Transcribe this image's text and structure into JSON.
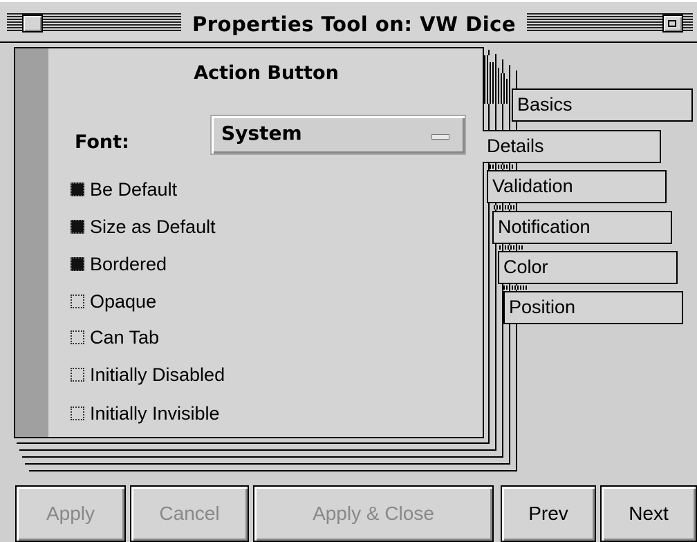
{
  "window": {
    "title": "Properties Tool on: VW Dice"
  },
  "page": {
    "title": "Action Button",
    "font_label": "Font:",
    "font_value": "System"
  },
  "options": [
    {
      "label": "Be Default",
      "checked": true
    },
    {
      "label": "Size as Default",
      "checked": true
    },
    {
      "label": "Bordered",
      "checked": true
    },
    {
      "label": "Opaque",
      "checked": false
    },
    {
      "label": "Can Tab",
      "checked": false
    },
    {
      "label": "Initially Disabled",
      "checked": false
    },
    {
      "label": "Initially Invisible",
      "checked": false
    }
  ],
  "tabs": [
    {
      "label": "Basics"
    },
    {
      "label": "Details",
      "selected": true
    },
    {
      "label": "Validation"
    },
    {
      "label": "Notification"
    },
    {
      "label": "Color"
    },
    {
      "label": "Position"
    }
  ],
  "buttons": {
    "apply": {
      "label": "Apply",
      "enabled": false
    },
    "cancel": {
      "label": "Cancel",
      "enabled": false
    },
    "apply_close": {
      "label": "Apply & Close",
      "enabled": false
    },
    "prev": {
      "label": "Prev",
      "enabled": true
    },
    "next": {
      "label": "Next",
      "enabled": true
    }
  }
}
